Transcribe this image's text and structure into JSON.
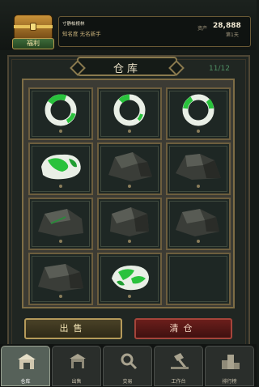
{
  "header": {
    "chest_label": "福利",
    "player_name": "寸静柏根林",
    "player_rank": "知名度 无名新手",
    "asset_label": "资产",
    "asset_value": "28,888",
    "day_label": "第1天"
  },
  "warehouse": {
    "title": "仓库",
    "capacity": "11/12",
    "slots": [
      {
        "item": "green-jade-bangle-icon"
      },
      {
        "item": "green-jade-bangle-icon"
      },
      {
        "item": "green-jade-bangle-icon"
      },
      {
        "item": "green-jade-rough-stone-icon"
      },
      {
        "item": "raw-stone-icon"
      },
      {
        "item": "raw-stone-icon"
      },
      {
        "item": "raw-stone-icon"
      },
      {
        "item": "raw-stone-icon"
      },
      {
        "item": "raw-stone-icon"
      },
      {
        "item": "raw-stone-icon"
      },
      {
        "item": "green-jade-rough-stone-icon"
      },
      {
        "item": "empty"
      }
    ]
  },
  "actions": {
    "sell_label": "出售",
    "clear_label": "清仓"
  },
  "nav": {
    "tabs": [
      {
        "label": "仓库",
        "icon": "warehouse-icon",
        "active": true
      },
      {
        "label": "出售",
        "icon": "shop-icon",
        "active": false
      },
      {
        "label": "交易",
        "icon": "search-icon",
        "active": false
      },
      {
        "label": "工作台",
        "icon": "hammer-icon",
        "active": false
      },
      {
        "label": "排行榜",
        "icon": "podium-icon",
        "active": false
      }
    ]
  },
  "colors": {
    "jade_green": "#29c23c",
    "jade_white": "#e9efe6",
    "stone_dark": "#3a3d38",
    "frame_gold": "#7e6d45",
    "sell_button": "#2e2917",
    "clear_button": "#6b1e1b"
  }
}
